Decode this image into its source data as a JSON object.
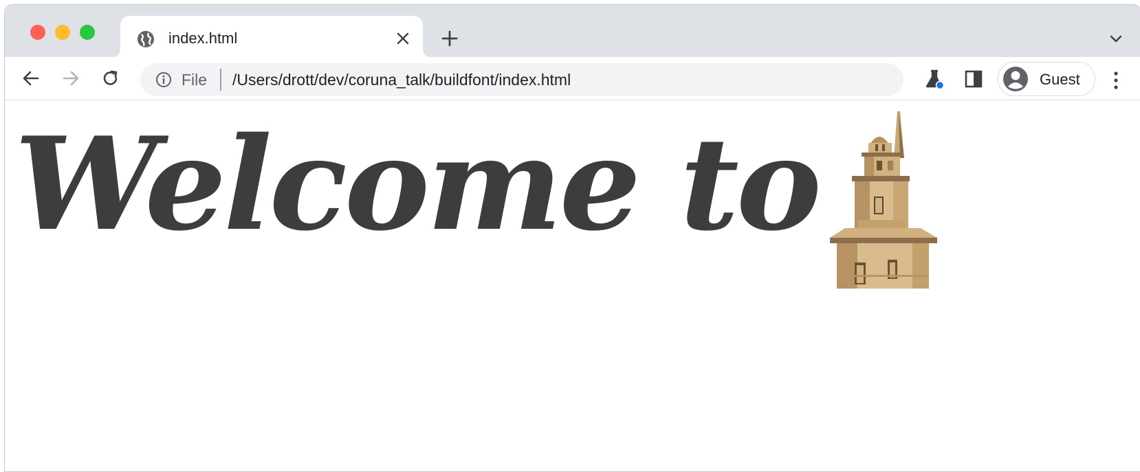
{
  "window": {
    "traffic_lights": [
      "close",
      "minimize",
      "zoom"
    ]
  },
  "tab": {
    "title": "index.html",
    "favicon": "globe-icon"
  },
  "omnibox": {
    "scheme_label": "File",
    "url": "/Users/drott/dev/coruna_talk/buildfont/index.html"
  },
  "profile": {
    "name": "Guest"
  },
  "page": {
    "headline": "Welcome to",
    "image": "lighthouse-tower-illustration"
  },
  "colors": {
    "tabstrip": "#dee1e6",
    "omnibox": "#f1f3f4",
    "headline": "#3d3d3d",
    "tower_light": "#d2b180",
    "tower_dark": "#8c6e4a"
  }
}
